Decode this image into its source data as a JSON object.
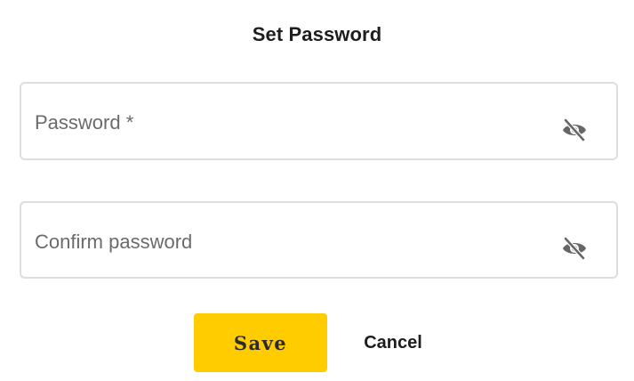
{
  "dialog": {
    "title": "Set Password"
  },
  "fields": {
    "password": {
      "placeholder": "Password *",
      "value": "",
      "toggle_icon": "eye-off-icon"
    },
    "confirm": {
      "placeholder": "Confirm password",
      "value": "",
      "toggle_icon": "eye-off-icon"
    }
  },
  "actions": {
    "save_label": "Save",
    "cancel_label": "Cancel"
  },
  "colors": {
    "accent": "#ffcc00",
    "border": "#dedede",
    "icon": "#666666",
    "text": "#1e1e1e"
  }
}
